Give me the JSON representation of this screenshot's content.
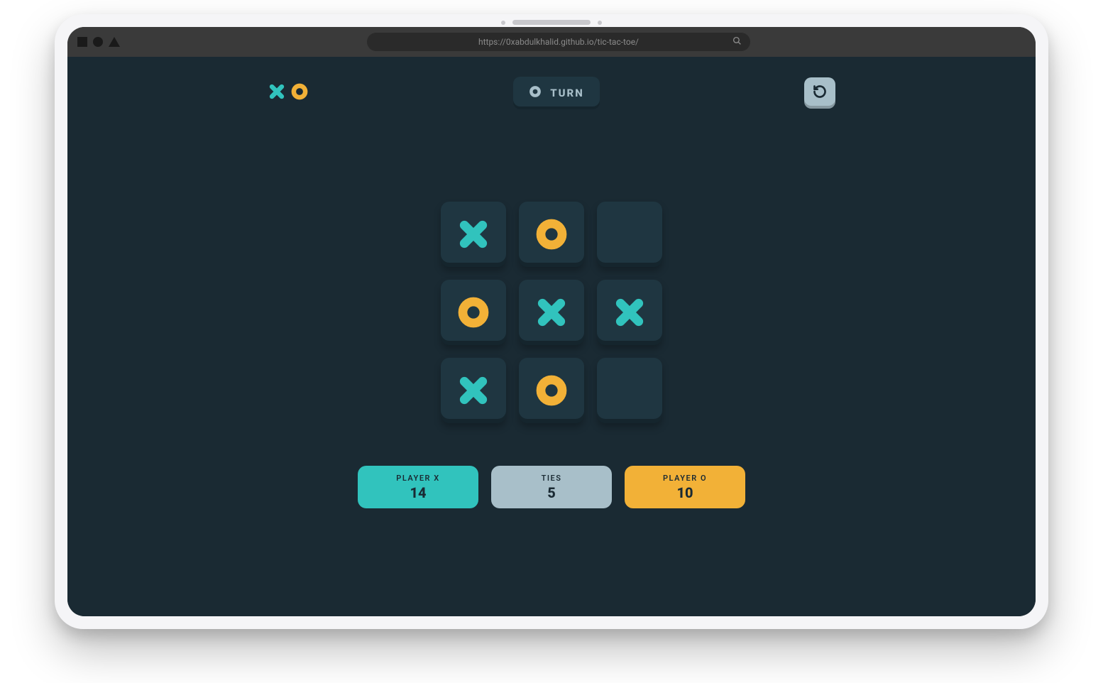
{
  "browser": {
    "url": "https://0xabdulkhalid.github.io/tic-tac-toe/"
  },
  "colors": {
    "bg": "#1a2a33",
    "cell": "#1f3641",
    "x": "#31c3bd",
    "o": "#f2b137",
    "silver": "#a8bfc9"
  },
  "header": {
    "turn_label": "TURN",
    "current_turn": "O"
  },
  "board": {
    "cells": [
      "X",
      "O",
      "",
      "O",
      "X",
      "X",
      "X",
      "O",
      ""
    ]
  },
  "scores": {
    "player_x": {
      "label": "PLAYER X",
      "value": "14"
    },
    "ties": {
      "label": "TIES",
      "value": "5"
    },
    "player_o": {
      "label": "PLAYER O",
      "value": "10"
    }
  }
}
